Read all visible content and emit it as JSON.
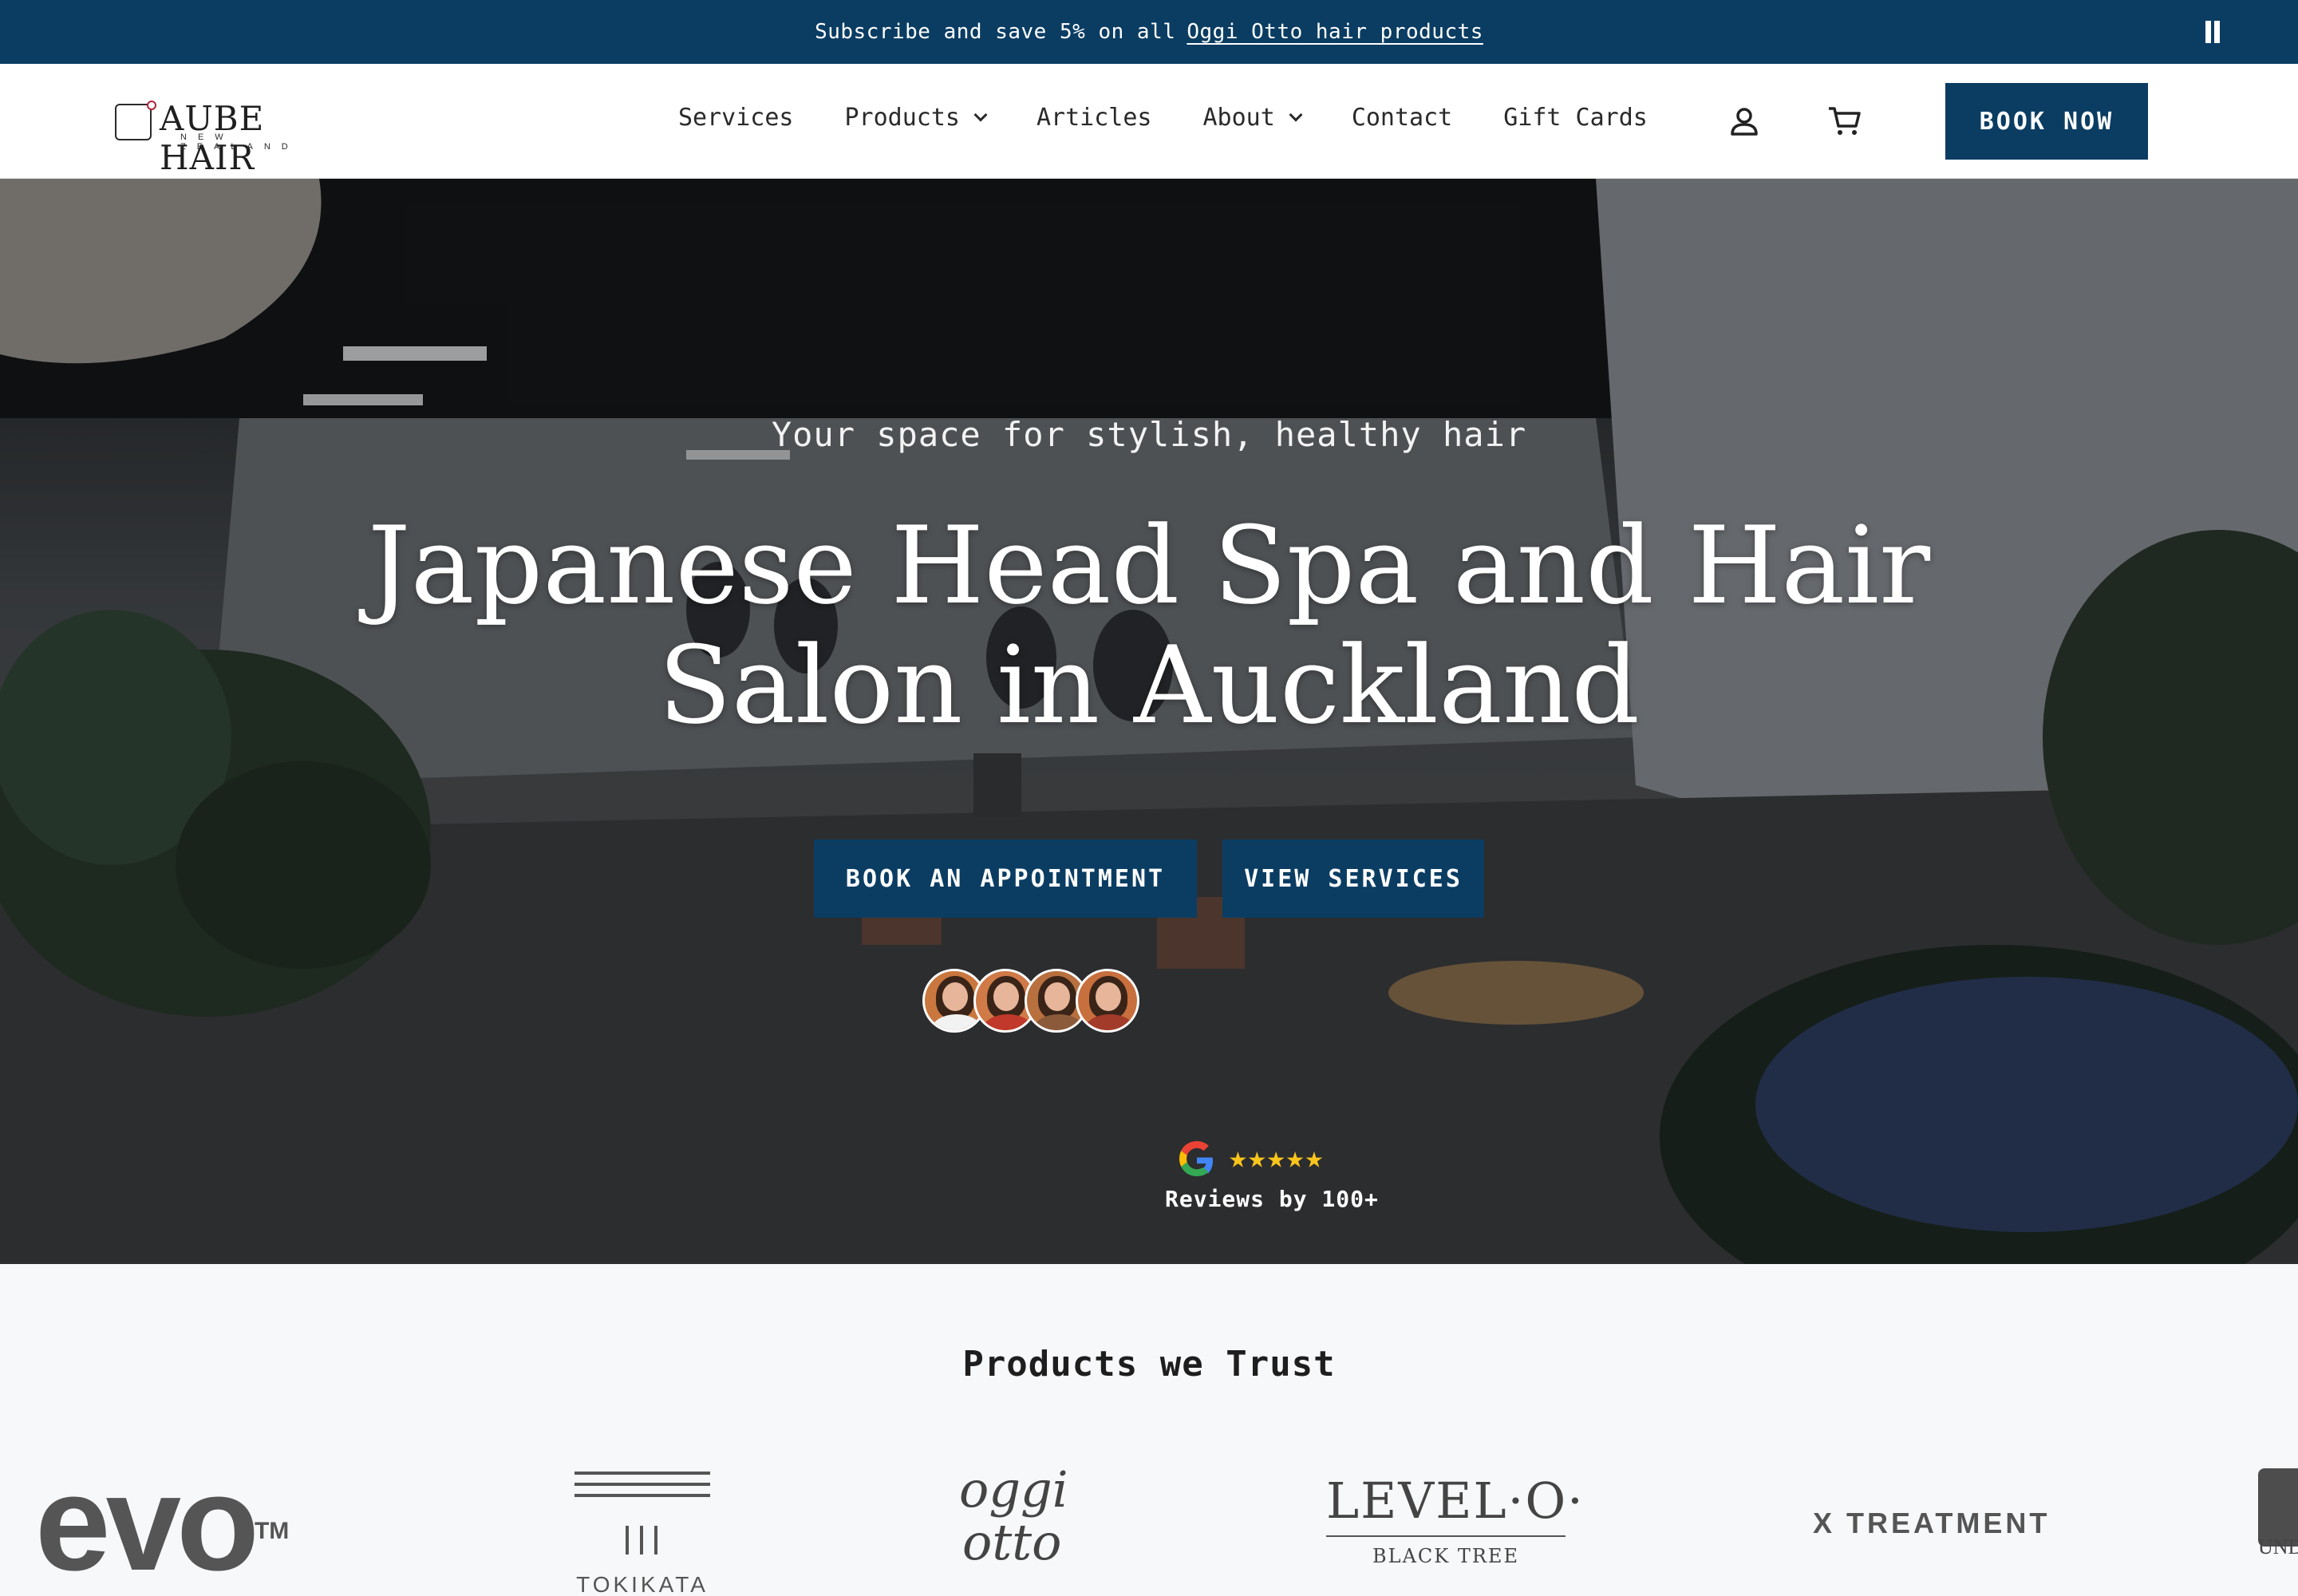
{
  "announcement": {
    "text": "Subscribe and save 5% on all",
    "link": "Oggi Otto hair products"
  },
  "logo": {
    "name": "AUBE HAIR",
    "sub": "NEW ZEALAND"
  },
  "nav": {
    "items": [
      "Services",
      "Products",
      "Articles",
      "About",
      "Contact",
      "Gift Cards"
    ]
  },
  "header": {
    "book_now": "BOOK NOW"
  },
  "hero": {
    "tagline": "Your space for stylish, healthy hair",
    "title_line1": "Japanese Head Spa and Hair",
    "title_line2": "Salon in Auckland",
    "book_btn": "BOOK AN APPOINTMENT",
    "services_btn": "VIEW SERVICES",
    "stars": "★★★★★",
    "rating": 5,
    "reviews": "Reviews by 100+"
  },
  "products": {
    "title": "Products we Trust",
    "brands": [
      "evo",
      "TOKIKATA",
      "oggi otto",
      "LEVEL·O·",
      "BLACK TREE",
      "X TREATMENT",
      "UND"
    ]
  },
  "colors": {
    "brand": "#0b3d63",
    "star": "#f8c51c",
    "section_bg": "#f7f8fa"
  },
  "icons": [
    "pause-icon",
    "user-icon",
    "cart-icon",
    "google-icon"
  ]
}
